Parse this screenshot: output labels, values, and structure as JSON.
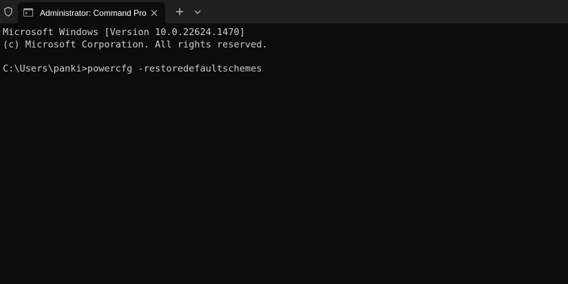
{
  "window": {
    "tab_title": "Administrator: Command Pro"
  },
  "icons": {
    "shield": "shield-icon",
    "tab_terminal": "terminal-icon",
    "tab_close": "close-icon",
    "new_tab": "plus-icon",
    "dropdown": "chevron-down-icon"
  },
  "colors": {
    "titlebar_bg": "#202020",
    "terminal_bg": "#0c0c0c",
    "terminal_text": "#cccccc",
    "tab_text": "#ffffff"
  },
  "terminal": {
    "lines": [
      "Microsoft Windows [Version 10.0.22624.1470]",
      "(c) Microsoft Corporation. All rights reserved.",
      "",
      "C:\\Users\\panki>powercfg -restoredefaultschemes"
    ]
  }
}
